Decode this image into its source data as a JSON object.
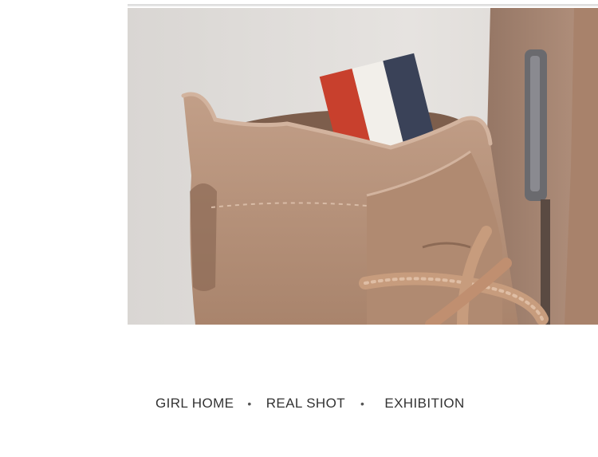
{
  "photo": {
    "subject": "tan suede lace-up boot collar with striped pull tab and side zipper",
    "colors": {
      "background": "#e2dfdc",
      "suede": "#b48f76",
      "suede_shadow": "#8c6a55",
      "suede_light": "#c8a791",
      "tab_red": "#c8402d",
      "tab_white": "#f2efea",
      "tab_navy": "#3a4258",
      "lace": "#c79c7d",
      "zipper": "#6a6a6e"
    }
  },
  "caption": {
    "item1": "GIRL HOME",
    "separator1": "•",
    "item2": "REAL SHOT",
    "separator2": "•",
    "item3": "EXHIBITION"
  }
}
